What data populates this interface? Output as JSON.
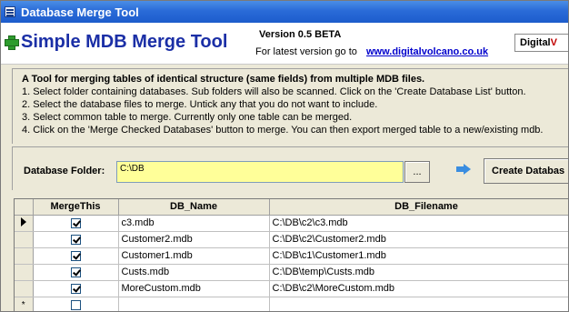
{
  "window": {
    "title": "Database Merge Tool"
  },
  "header": {
    "app_title": "Simple MDB Merge Tool",
    "version": "Version 0.5 BETA",
    "latest_text": "For latest version go to",
    "site_link": "www.digitalvolcano.co.uk",
    "brand_part1": "Digital",
    "brand_part2": "V"
  },
  "instructions": {
    "intro": "A Tool for merging tables of identical structure (same fields) from multiple MDB files.",
    "steps": [
      "1. Select folder containing databases. Sub folders will also be scanned.  Click on the 'Create Database List' button.",
      "2. Select the database files to merge.  Untick any that you do not want to include.",
      "3. Select common table to merge.  Currently only one table can be merged.",
      "4. Click on the 'Merge Checked Databases' button to merge. You can then export merged table to a new/existing mdb."
    ]
  },
  "folder": {
    "label": "Database Folder:",
    "value": "C:\\DB",
    "browse_label": "...",
    "create_button": "Create Databas"
  },
  "grid": {
    "columns": [
      "MergeThis",
      "DB_Name",
      "DB_Filename"
    ],
    "rows": [
      {
        "checked": true,
        "name": "c3.mdb",
        "file": "C:\\DB\\c2\\c3.mdb"
      },
      {
        "checked": true,
        "name": "Customer2.mdb",
        "file": "C:\\DB\\c2\\Customer2.mdb"
      },
      {
        "checked": true,
        "name": "Customer1.mdb",
        "file": "C:\\DB\\c1\\Customer1.mdb"
      },
      {
        "checked": true,
        "name": "Custs.mdb",
        "file": "C:\\DB\\temp\\Custs.mdb"
      },
      {
        "checked": true,
        "name": "MoreCustom.mdb",
        "file": "C:\\DB\\c2\\MoreCustom.mdb"
      },
      {
        "checked": false,
        "name": "",
        "file": ""
      }
    ],
    "current_row_marker": "row-pointer-icon",
    "new_row_marker": "*"
  },
  "colors": {
    "titlebar": "#2a6bd8",
    "title_text": "#1b2fa6",
    "folder_input_bg": "#ffff99",
    "link": "#0000cc"
  }
}
